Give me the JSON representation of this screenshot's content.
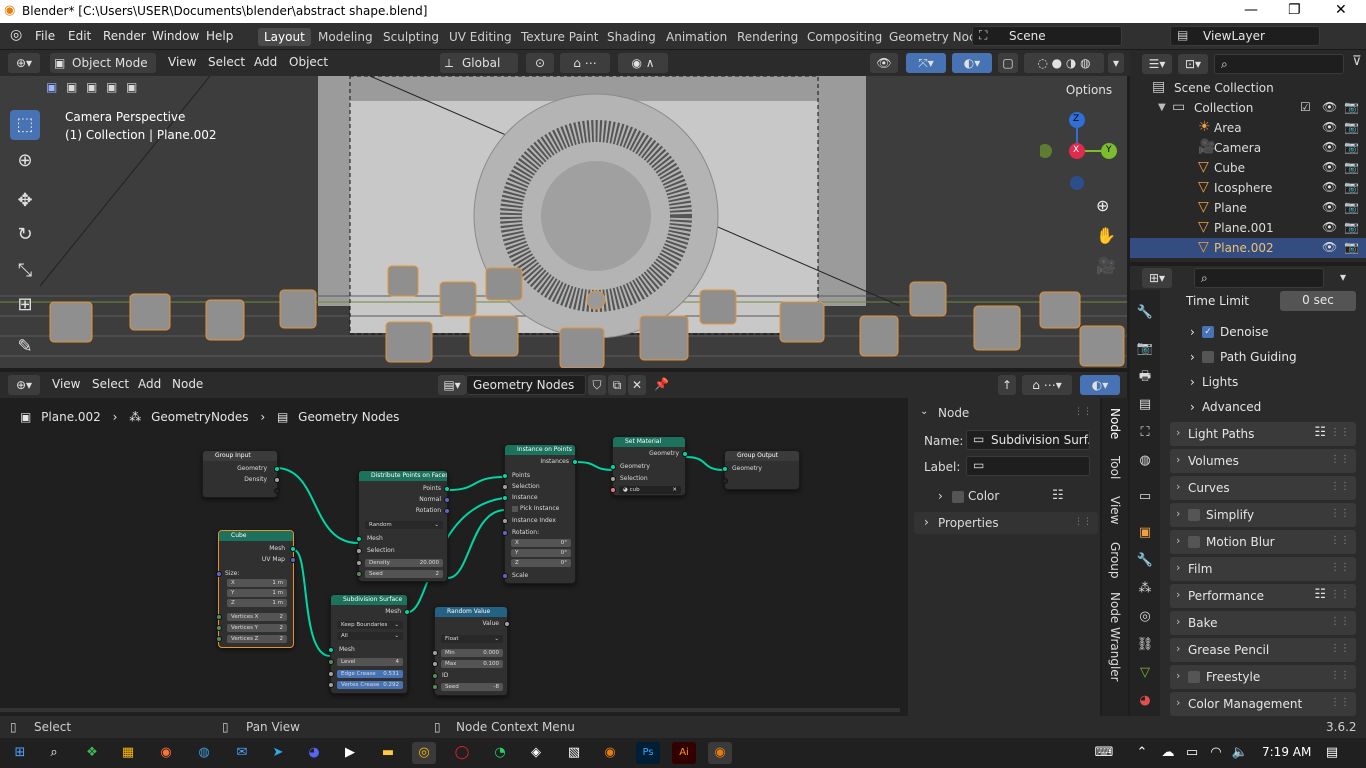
{
  "window": {
    "title": "Blender* [C:\\Users\\USER\\Documents\\blender\\abstract shape.blend]",
    "minimize": "—",
    "maximize": "❐",
    "close": "✕"
  },
  "menu": {
    "file": "File",
    "edit": "Edit",
    "render": "Render",
    "window": "Window",
    "help": "Help"
  },
  "workspaces": [
    "Layout",
    "Modeling",
    "Sculpting",
    "UV Editing",
    "Texture Paint",
    "Shading",
    "Animation",
    "Rendering",
    "Compositing",
    "Geometry Noc"
  ],
  "scene": {
    "name": "Scene",
    "view_layer": "ViewLayer"
  },
  "viewport": {
    "mode": "Object Mode",
    "view": "View",
    "select": "Select",
    "add": "Add",
    "object": "Object",
    "transform": "Global",
    "options": "Options",
    "overlay_title": "Camera Perspective",
    "overlay_sub": "(1) Collection | Plane.002",
    "gizmo_x": "X",
    "gizmo_y": "Y",
    "gizmo_z": "Z"
  },
  "outliner": {
    "root": "Scene Collection",
    "collection": "Collection",
    "items": [
      "Area",
      "Camera",
      "Cube",
      "Icosphere",
      "Plane",
      "Plane.001",
      "Plane.002"
    ],
    "selected": "Plane.002"
  },
  "properties": {
    "time_limit_label": "Time Limit",
    "time_limit_value": "0 sec",
    "sub": [
      "Denoise",
      "Path Guiding",
      "Lights",
      "Advanced"
    ],
    "panels": [
      "Light Paths",
      "Volumes",
      "Curves",
      "Simplify",
      "Motion Blur",
      "Film",
      "Performance",
      "Bake",
      "Grease Pencil",
      "Freestyle",
      "Color Management"
    ]
  },
  "node_editor": {
    "view": "View",
    "select": "Select",
    "add": "Add",
    "node": "Node",
    "tree_name": "Geometry Nodes",
    "breadcrumb": [
      "Plane.002",
      "GeometryNodes",
      "Geometry Nodes"
    ]
  },
  "nodes": {
    "group_input": {
      "title": "Group Input",
      "out1": "Geometry",
      "out2": "Density"
    },
    "cube": {
      "title": "Cube",
      "out1": "Mesh",
      "out2": "UV Map",
      "size": "Size:",
      "x": "X",
      "y": "Y",
      "z": "Z",
      "xv": "1 m",
      "yv": "1 m",
      "zv": "1 m",
      "vx": "Vertices X",
      "vy": "Vertices Y",
      "vz": "Vertices Z",
      "vxv": "2",
      "vyv": "2",
      "vzv": "2"
    },
    "distribute": {
      "title": "Distribute Points on Faces",
      "o1": "Points",
      "o2": "Normal",
      "o3": "Rotation",
      "mode": "Random",
      "mesh": "Mesh",
      "selection": "Selection",
      "density": "Density",
      "density_v": "20.000",
      "seed": "Seed",
      "seed_v": "2"
    },
    "subdiv": {
      "title": "Subdivision Surface",
      "out": "Mesh",
      "boundary": "Keep Boundaries",
      "all": "All",
      "mesh": "Mesh",
      "level": "Level",
      "level_v": "4",
      "edge": "Edge Crease",
      "edge_v": "0.531",
      "vertex": "Vertex Crease",
      "vertex_v": "0.292"
    },
    "instance": {
      "title": "Instance on Points",
      "out": "Instances",
      "points": "Points",
      "selection": "Selection",
      "instance": "Instance",
      "pick": "Pick Instance",
      "index": "Instance Index",
      "rotation": "Rotation:",
      "x": "X",
      "y": "Y",
      "z": "Z",
      "xv": "0°",
      "yv": "0°",
      "zv": "0°",
      "scale": "Scale"
    },
    "random": {
      "title": "Random Value",
      "out": "Value",
      "type": "Float",
      "min": "Min",
      "min_v": "0.000",
      "max": "Max",
      "max_v": "0.100",
      "id": "ID",
      "seed": "Seed",
      "seed_v": "-8"
    },
    "set_material": {
      "title": "Set Material",
      "out": "Geometry",
      "geo": "Geometry",
      "selection": "Selection",
      "mat": "cub"
    },
    "group_output": {
      "title": "Group Output",
      "in": "Geometry"
    }
  },
  "npanel": {
    "node_header": "Node",
    "name_label": "Name:",
    "name_value": "Subdivision Surf...",
    "label_label": "Label:",
    "label_value": "",
    "color": "Color",
    "properties": "Properties",
    "tabs": [
      "Node",
      "Tool",
      "View",
      "Group",
      "Node Wrangler"
    ]
  },
  "status": {
    "select": "Select",
    "pan": "Pan View",
    "context": "Node Context Menu",
    "version": "3.6.2"
  },
  "taskbar": {
    "time": "7:19 AM"
  }
}
